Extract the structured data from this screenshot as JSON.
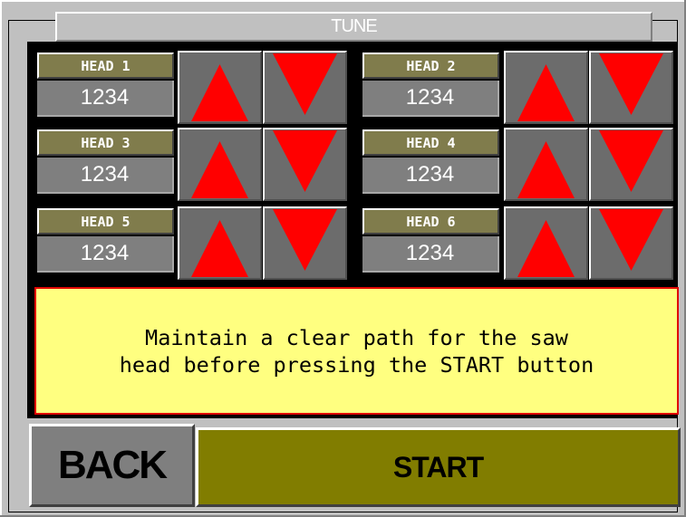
{
  "title": "TUNE",
  "heads": [
    {
      "label": "HEAD 1",
      "value": "1234"
    },
    {
      "label": "HEAD 2",
      "value": "1234"
    },
    {
      "label": "HEAD 3",
      "value": "1234"
    },
    {
      "label": "HEAD 4",
      "value": "1234"
    },
    {
      "label": "HEAD 5",
      "value": "1234"
    },
    {
      "label": "HEAD 6",
      "value": "1234"
    }
  ],
  "icons": {
    "up": "arrow-up-icon",
    "down": "arrow-down-icon"
  },
  "message": {
    "line1": "Maintain a clear path for the saw",
    "line2": "head before pressing the START button"
  },
  "buttons": {
    "back": "BACK",
    "start": "START"
  },
  "colors": {
    "arrow": "#ff0000",
    "label_bg": "#807c4c",
    "value_bg": "#7f7f7f",
    "message_bg": "#ffff80",
    "message_border": "#e00000",
    "start_bg": "#817d00"
  }
}
